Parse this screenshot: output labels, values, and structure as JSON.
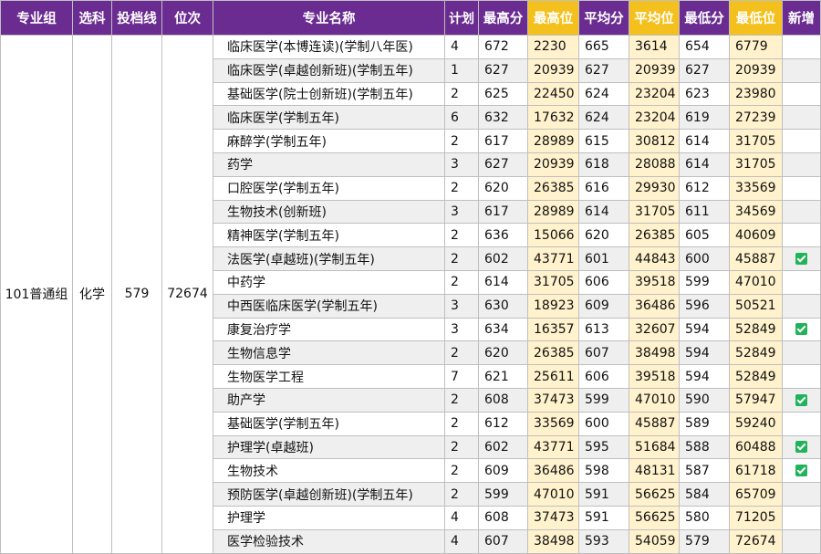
{
  "headers": {
    "group": "专业组",
    "subject": "选科",
    "cutoff": "投档线",
    "rank": "位次",
    "major": "专业名称",
    "plan": "计划",
    "max_score": "最高分",
    "max_rank": "最高位",
    "avg_score": "平均分",
    "avg_rank": "平均位",
    "min_score": "最低分",
    "min_rank": "最低位",
    "is_new": "新增"
  },
  "group_info": {
    "group": "101普通组",
    "subject": "化学",
    "cutoff": "579",
    "rank": "72674"
  },
  "rows": [
    {
      "major": "临床医学(本博连读)(学制八年医)",
      "plan": "4",
      "max_score": "672",
      "max_rank": "2230",
      "avg_score": "665",
      "avg_rank": "3614",
      "min_score": "654",
      "min_rank": "6779",
      "is_new": false
    },
    {
      "major": "临床医学(卓越创新班)(学制五年)",
      "plan": "1",
      "max_score": "627",
      "max_rank": "20939",
      "avg_score": "627",
      "avg_rank": "20939",
      "min_score": "627",
      "min_rank": "20939",
      "is_new": false
    },
    {
      "major": "基础医学(院士创新班)(学制五年)",
      "plan": "2",
      "max_score": "625",
      "max_rank": "22450",
      "avg_score": "624",
      "avg_rank": "23204",
      "min_score": "623",
      "min_rank": "23980",
      "is_new": false
    },
    {
      "major": "临床医学(学制五年)",
      "plan": "6",
      "max_score": "632",
      "max_rank": "17632",
      "avg_score": "624",
      "avg_rank": "23204",
      "min_score": "619",
      "min_rank": "27239",
      "is_new": false
    },
    {
      "major": "麻醉学(学制五年)",
      "plan": "2",
      "max_score": "617",
      "max_rank": "28989",
      "avg_score": "615",
      "avg_rank": "30812",
      "min_score": "614",
      "min_rank": "31705",
      "is_new": false
    },
    {
      "major": "药学",
      "plan": "3",
      "max_score": "627",
      "max_rank": "20939",
      "avg_score": "618",
      "avg_rank": "28088",
      "min_score": "614",
      "min_rank": "31705",
      "is_new": false
    },
    {
      "major": "口腔医学(学制五年)",
      "plan": "2",
      "max_score": "620",
      "max_rank": "26385",
      "avg_score": "616",
      "avg_rank": "29930",
      "min_score": "612",
      "min_rank": "33569",
      "is_new": false
    },
    {
      "major": "生物技术(创新班)",
      "plan": "3",
      "max_score": "617",
      "max_rank": "28989",
      "avg_score": "614",
      "avg_rank": "31705",
      "min_score": "611",
      "min_rank": "34569",
      "is_new": false
    },
    {
      "major": "精神医学(学制五年)",
      "plan": "2",
      "max_score": "636",
      "max_rank": "15066",
      "avg_score": "620",
      "avg_rank": "26385",
      "min_score": "605",
      "min_rank": "40609",
      "is_new": false
    },
    {
      "major": "法医学(卓越班)(学制五年)",
      "plan": "2",
      "max_score": "602",
      "max_rank": "43771",
      "avg_score": "601",
      "avg_rank": "44843",
      "min_score": "600",
      "min_rank": "45887",
      "is_new": true
    },
    {
      "major": "中药学",
      "plan": "2",
      "max_score": "614",
      "max_rank": "31705",
      "avg_score": "606",
      "avg_rank": "39518",
      "min_score": "599",
      "min_rank": "47010",
      "is_new": false
    },
    {
      "major": "中西医临床医学(学制五年)",
      "plan": "3",
      "max_score": "630",
      "max_rank": "18923",
      "avg_score": "609",
      "avg_rank": "36486",
      "min_score": "596",
      "min_rank": "50521",
      "is_new": false
    },
    {
      "major": "康复治疗学",
      "plan": "3",
      "max_score": "634",
      "max_rank": "16357",
      "avg_score": "613",
      "avg_rank": "32607",
      "min_score": "594",
      "min_rank": "52849",
      "is_new": true
    },
    {
      "major": "生物信息学",
      "plan": "2",
      "max_score": "620",
      "max_rank": "26385",
      "avg_score": "607",
      "avg_rank": "38498",
      "min_score": "594",
      "min_rank": "52849",
      "is_new": false
    },
    {
      "major": "生物医学工程",
      "plan": "7",
      "max_score": "621",
      "max_rank": "25611",
      "avg_score": "606",
      "avg_rank": "39518",
      "min_score": "594",
      "min_rank": "52849",
      "is_new": false
    },
    {
      "major": "助产学",
      "plan": "2",
      "max_score": "608",
      "max_rank": "37473",
      "avg_score": "599",
      "avg_rank": "47010",
      "min_score": "590",
      "min_rank": "57947",
      "is_new": true
    },
    {
      "major": "基础医学(学制五年)",
      "plan": "2",
      "max_score": "612",
      "max_rank": "33569",
      "avg_score": "600",
      "avg_rank": "45887",
      "min_score": "589",
      "min_rank": "59240",
      "is_new": false
    },
    {
      "major": "护理学(卓越班)",
      "plan": "2",
      "max_score": "602",
      "max_rank": "43771",
      "avg_score": "595",
      "avg_rank": "51684",
      "min_score": "588",
      "min_rank": "60488",
      "is_new": true
    },
    {
      "major": "生物技术",
      "plan": "2",
      "max_score": "609",
      "max_rank": "36486",
      "avg_score": "598",
      "avg_rank": "48131",
      "min_score": "587",
      "min_rank": "61718",
      "is_new": true
    },
    {
      "major": "预防医学(卓越创新班)(学制五年)",
      "plan": "2",
      "max_score": "599",
      "max_rank": "47010",
      "avg_score": "591",
      "avg_rank": "56625",
      "min_score": "584",
      "min_rank": "65709",
      "is_new": false
    },
    {
      "major": "护理学",
      "plan": "4",
      "max_score": "608",
      "max_rank": "37473",
      "avg_score": "591",
      "avg_rank": "56625",
      "min_score": "580",
      "min_rank": "71205",
      "is_new": false
    },
    {
      "major": "医学检验技术",
      "plan": "4",
      "max_score": "607",
      "max_rank": "38498",
      "avg_score": "593",
      "avg_rank": "54059",
      "min_score": "579",
      "min_rank": "72674",
      "is_new": false
    }
  ],
  "icons": {
    "new_marker": "check-icon"
  },
  "colors": {
    "header_bg": "#6a2c91",
    "highlight_header_bg": "#f4c01e",
    "highlight_cell_bg": "#fff2cc",
    "check_green": "#21b35b"
  }
}
